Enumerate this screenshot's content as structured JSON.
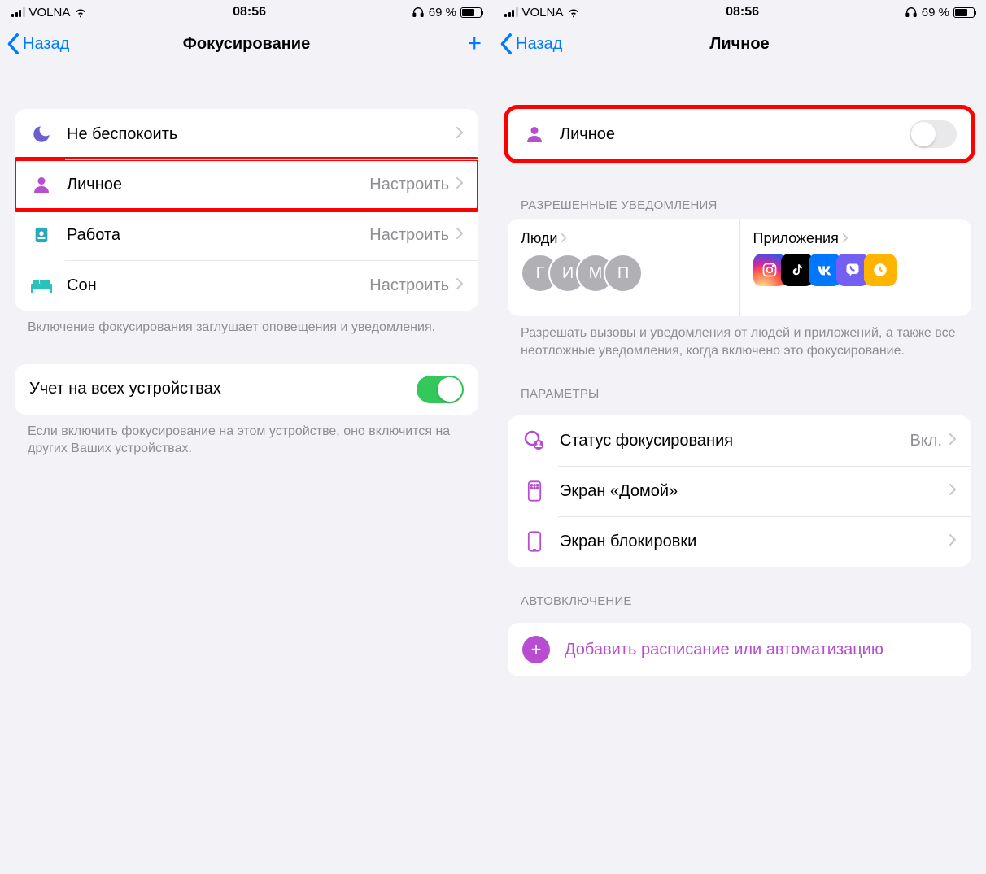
{
  "status": {
    "carrier": "VOLNA",
    "time": "08:56",
    "battery_pct": "69 %"
  },
  "left": {
    "nav_back": "Назад",
    "nav_title": "Фокусирование",
    "rows": {
      "dnd": "Не беспокоить",
      "personal": "Личное",
      "personal_value": "Настроить",
      "work": "Работа",
      "work_value": "Настроить",
      "sleep": "Сон",
      "sleep_value": "Настроить"
    },
    "footer1": "Включение фокусирования заглушает оповещения и уведомления.",
    "sync_label": "Учет на всех устройствах",
    "footer2": "Если включить фокусирование на этом устройстве, оно включится на других Ваших устройствах."
  },
  "right": {
    "nav_back": "Назад",
    "nav_title": "Личное",
    "toggle_label": "Личное",
    "section_allowed": "РАЗРЕШЕННЫЕ УВЕДОМЛЕНИЯ",
    "people_label": "Люди",
    "apps_label": "Приложения",
    "people_initials": [
      "Г",
      "И",
      "М",
      "П"
    ],
    "app_icons": [
      "instagram",
      "tiktok",
      "vk",
      "viber",
      "clock"
    ],
    "allowed_footer": "Разрешать вызовы и уведомления от людей и приложений, а также все неотложные уведомления, когда включено это фокусирование.",
    "section_params": "ПАРАМЕТРЫ",
    "params": {
      "status": "Статус фокусирования",
      "status_value": "Вкл.",
      "home": "Экран «Домой»",
      "lock": "Экран блокировки"
    },
    "section_auto": "АВТОВКЛЮЧЕНИЕ",
    "add_schedule": "Добавить расписание или автоматизацию"
  }
}
